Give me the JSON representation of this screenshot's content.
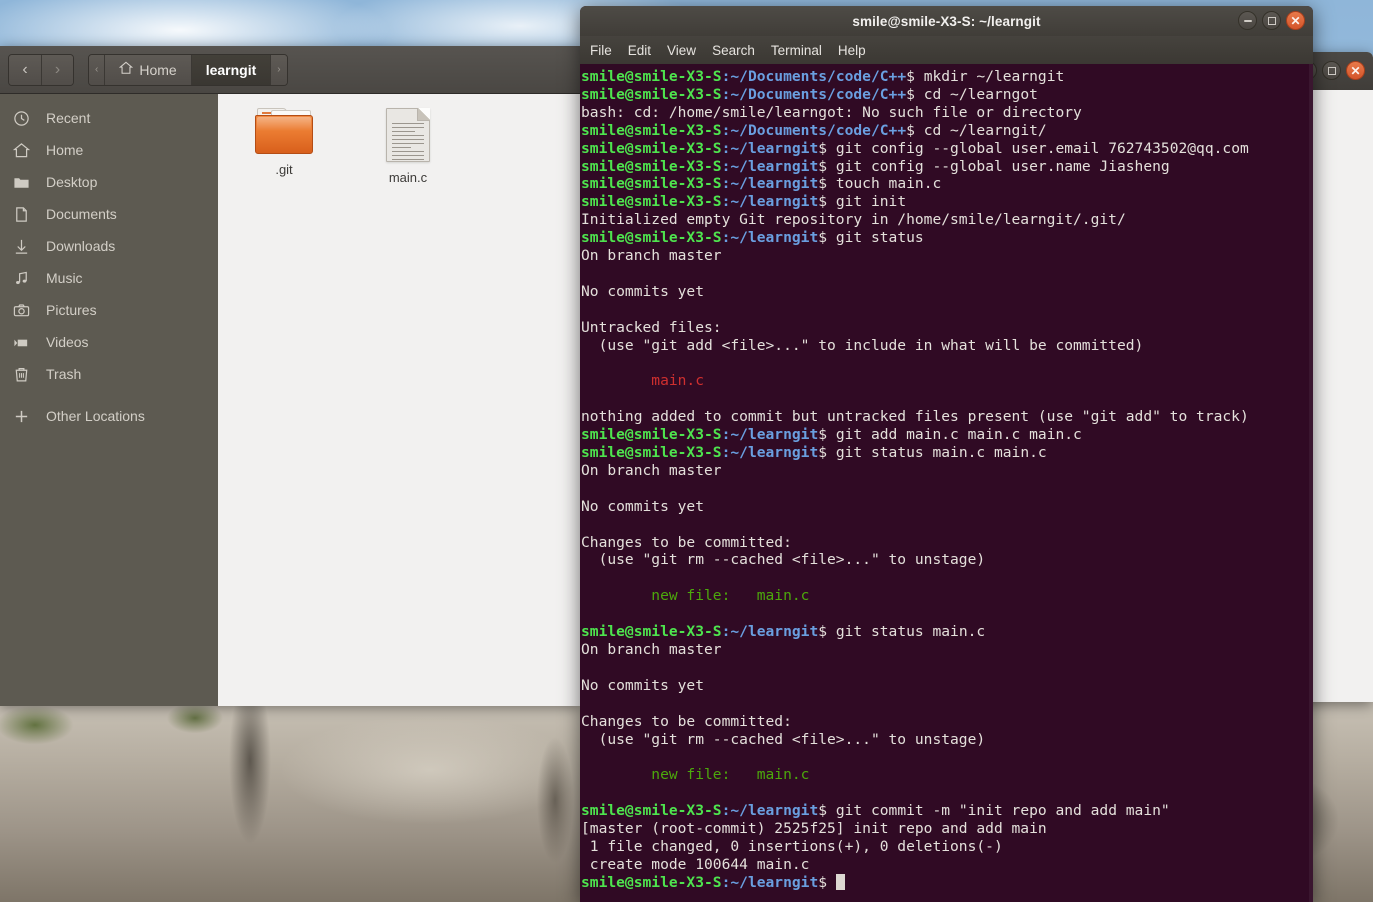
{
  "desktop": {
    "wallpaper_description": "rocky mountain cliff with blue cloudy sky"
  },
  "background_window": {
    "controls": [
      {
        "name": "minimize",
        "glyph": "–"
      },
      {
        "name": "maximize",
        "glyph": "□"
      },
      {
        "name": "close",
        "glyph": "×"
      }
    ]
  },
  "file_manager": {
    "nav": {
      "back": "‹",
      "forward": "›"
    },
    "breadcrumbs": [
      {
        "label": "‹",
        "type": "arrow",
        "active": false
      },
      {
        "label": "Home",
        "type": "crumb",
        "icon": "home-icon",
        "active": false
      },
      {
        "label": "learngit",
        "type": "crumb",
        "active": true
      },
      {
        "label": "›",
        "type": "arrow",
        "active": false
      }
    ],
    "sidebar": [
      {
        "label": "Recent",
        "icon": "clock-icon"
      },
      {
        "label": "Home",
        "icon": "home-icon"
      },
      {
        "label": "Desktop",
        "icon": "folder-icon"
      },
      {
        "label": "Documents",
        "icon": "document-icon"
      },
      {
        "label": "Downloads",
        "icon": "download-icon"
      },
      {
        "label": "Music",
        "icon": "music-note-icon"
      },
      {
        "label": "Pictures",
        "icon": "camera-icon"
      },
      {
        "label": "Videos",
        "icon": "video-icon"
      },
      {
        "label": "Trash",
        "icon": "trash-icon"
      },
      {
        "label": "Other Locations",
        "icon": "plus-icon"
      }
    ],
    "items": [
      {
        "label": ".git",
        "kind": "folder"
      },
      {
        "label": "main.c",
        "kind": "document"
      }
    ]
  },
  "terminal": {
    "title": "smile@smile-X3-S: ~/learngit",
    "menu": [
      "File",
      "Edit",
      "View",
      "Search",
      "Terminal",
      "Help"
    ],
    "controls": [
      {
        "name": "minimize",
        "glyph": "–"
      },
      {
        "name": "maximize",
        "glyph": "□"
      },
      {
        "name": "close",
        "glyph": "×"
      }
    ],
    "colors": {
      "background": "#300a24",
      "foreground": "#e4e0db",
      "user": "#4ee44e",
      "path": "#6a9fe0",
      "untracked": "#cf2f2f",
      "staged": "#4ca80c"
    },
    "prompts": {
      "user_host": "smile@smile-X3-S",
      "path_cpp": ":~/Documents/code/C++",
      "path_learngit": ":~/learngit",
      "dollar": "$ "
    },
    "lines": [
      {
        "type": "prompt",
        "path": ":~/Documents/code/C++",
        "cmd": "mkdir ~/learngit"
      },
      {
        "type": "prompt",
        "path": ":~/Documents/code/C++",
        "cmd": "cd ~/learngot"
      },
      {
        "type": "out",
        "text": "bash: cd: /home/smile/learngot: No such file or directory"
      },
      {
        "type": "prompt",
        "path": ":~/Documents/code/C++",
        "cmd": "cd ~/learngit/"
      },
      {
        "type": "prompt",
        "path": ":~/learngit",
        "cmd": "git config --global user.email 762743502@qq.com"
      },
      {
        "type": "prompt",
        "path": ":~/learngit",
        "cmd": "git config --global user.name Jiasheng"
      },
      {
        "type": "prompt",
        "path": ":~/learngit",
        "cmd": "touch main.c"
      },
      {
        "type": "prompt",
        "path": ":~/learngit",
        "cmd": "git init"
      },
      {
        "type": "out",
        "text": "Initialized empty Git repository in /home/smile/learngit/.git/"
      },
      {
        "type": "prompt",
        "path": ":~/learngit",
        "cmd": "git status"
      },
      {
        "type": "out",
        "text": "On branch master"
      },
      {
        "type": "out",
        "text": ""
      },
      {
        "type": "out",
        "text": "No commits yet"
      },
      {
        "type": "out",
        "text": ""
      },
      {
        "type": "out",
        "text": "Untracked files:"
      },
      {
        "type": "out",
        "text": "  (use \"git add <file>...\" to include in what will be committed)"
      },
      {
        "type": "out",
        "text": ""
      },
      {
        "type": "red",
        "text": "        main.c"
      },
      {
        "type": "out",
        "text": ""
      },
      {
        "type": "out",
        "text": "nothing added to commit but untracked files present (use \"git add\" to track)"
      },
      {
        "type": "prompt",
        "path": ":~/learngit",
        "cmd": "git add main.c main.c main.c"
      },
      {
        "type": "prompt",
        "path": ":~/learngit",
        "cmd": "git status main.c main.c"
      },
      {
        "type": "out",
        "text": "On branch master"
      },
      {
        "type": "out",
        "text": ""
      },
      {
        "type": "out",
        "text": "No commits yet"
      },
      {
        "type": "out",
        "text": ""
      },
      {
        "type": "out",
        "text": "Changes to be committed:"
      },
      {
        "type": "out",
        "text": "  (use \"git rm --cached <file>...\" to unstage)"
      },
      {
        "type": "out",
        "text": ""
      },
      {
        "type": "green",
        "text": "        new file:   main.c"
      },
      {
        "type": "out",
        "text": ""
      },
      {
        "type": "prompt",
        "path": ":~/learngit",
        "cmd": "git status main.c"
      },
      {
        "type": "out",
        "text": "On branch master"
      },
      {
        "type": "out",
        "text": ""
      },
      {
        "type": "out",
        "text": "No commits yet"
      },
      {
        "type": "out",
        "text": ""
      },
      {
        "type": "out",
        "text": "Changes to be committed:"
      },
      {
        "type": "out",
        "text": "  (use \"git rm --cached <file>...\" to unstage)"
      },
      {
        "type": "out",
        "text": ""
      },
      {
        "type": "green",
        "text": "        new file:   main.c"
      },
      {
        "type": "out",
        "text": ""
      },
      {
        "type": "prompt",
        "path": ":~/learngit",
        "cmd": "git commit -m \"init repo and add main\""
      },
      {
        "type": "out",
        "text": "[master (root-commit) 2525f25] init repo and add main"
      },
      {
        "type": "out",
        "text": " 1 file changed, 0 insertions(+), 0 deletions(-)"
      },
      {
        "type": "out",
        "text": " create mode 100644 main.c"
      },
      {
        "type": "cursor",
        "path": ":~/learngit",
        "cmd": ""
      }
    ]
  }
}
